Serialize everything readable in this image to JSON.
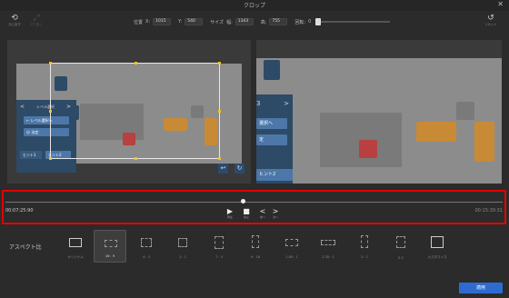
{
  "window": {
    "title": "クロップ",
    "close": "✕"
  },
  "toolbar": {
    "reset_all": {
      "glyph": "⟲",
      "label": "元に戻す"
    },
    "redo": {
      "glyph": "⤢",
      "label": "やり直し"
    },
    "reset": {
      "glyph": "↺",
      "label": "リセット"
    },
    "position_label": "位置",
    "x_label": "X:",
    "x_value": "1015",
    "y_label": "Y:",
    "y_value": "540",
    "size_label": "サイズ",
    "width_label": "幅:",
    "width_value": "1343",
    "height_label": "高:",
    "height_value": "755",
    "rotation_label": "回転:",
    "rotation_value": "0"
  },
  "left_panel": {
    "title": "レベル選択",
    "prev": "<",
    "next": ">",
    "item1": "← レベル選択へ",
    "item2": "☺ 決定",
    "hint1": "ヒント1",
    "hint2": "ヒント2"
  },
  "right_panel": {
    "header": "3",
    "next": ">",
    "item1": "選択へ",
    "item2": "定",
    "hint": "ヒント2"
  },
  "preview_controls": {
    "back_icon": "↩",
    "rotate_icon": "↻"
  },
  "timeline": {
    "current_time": "00:07:25:90",
    "total_time": "00:15:39:31",
    "play": {
      "glyph": "▶",
      "label": "再生"
    },
    "stop": {
      "glyph": "■",
      "label": "停止"
    },
    "prev_frame": {
      "glyph": "<",
      "label": "前へ"
    },
    "next_frame": {
      "glyph": ">",
      "label": "次へ"
    }
  },
  "aspect": {
    "label": "アスペクト比",
    "options": [
      {
        "label": "オリジナル",
        "selected": false
      },
      {
        "label": "16：9",
        "selected": true
      },
      {
        "label": "4：3",
        "selected": false
      },
      {
        "label": "1：1",
        "selected": false
      },
      {
        "label": "7：4",
        "selected": false
      },
      {
        "label": "9：16",
        "selected": false
      },
      {
        "label": "1.85：1",
        "selected": false
      },
      {
        "label": "2.35：1",
        "selected": false
      },
      {
        "label": "3：1",
        "selected": false
      },
      {
        "label": "5:2",
        "selected": false
      },
      {
        "label": "カスタマイズ",
        "selected": false
      }
    ]
  },
  "apply_button": "適用",
  "colors": {
    "highlight_border": "#e40000",
    "apply_blue": "#2f6bcf",
    "handle_yellow": "#f5c518",
    "panel_navy": "#2d4a66",
    "box_orange": "#c98a35",
    "box_red": "#b84040",
    "box_navy": "#2d4a66"
  }
}
